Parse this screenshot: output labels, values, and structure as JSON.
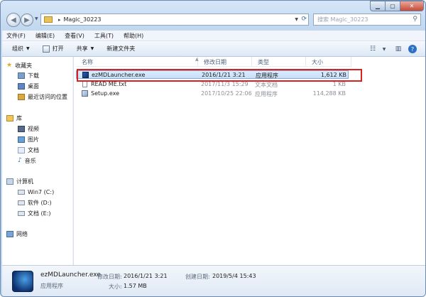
{
  "address": {
    "path": "Magic_30223"
  },
  "search": {
    "placeholder": "搜索 Magic_30223"
  },
  "menu": [
    "文件(F)",
    "编辑(E)",
    "查看(V)",
    "工具(T)",
    "帮助(H)"
  ],
  "toolbar": {
    "organize": "组织",
    "open": "打开",
    "share": "共享",
    "new_folder": "新建文件夹"
  },
  "nav": {
    "favorites": {
      "label": "收藏夹",
      "items": [
        "下载",
        "桌面",
        "最近访问的位置"
      ]
    },
    "library": {
      "label": "库",
      "items": [
        "视频",
        "图片",
        "文档",
        "音乐"
      ]
    },
    "computer": {
      "label": "计算机",
      "items": [
        "Win7 (C:)",
        "软件 (D:)",
        "文档 (E:)"
      ]
    },
    "network": {
      "label": "网络"
    }
  },
  "columns": [
    "名称",
    "修改日期",
    "类型",
    "大小"
  ],
  "files": [
    {
      "name": "ezMDLauncher.exe",
      "date": "2016/1/21 3:21",
      "type": "应用程序",
      "size": "1,612 KB"
    },
    {
      "name": "READ ME.txt",
      "date": "2017/11/3 15:29",
      "type": "文本文档",
      "size": "1 KB"
    },
    {
      "name": "Setup.exe",
      "date": "2017/10/25 22:06",
      "type": "应用程序",
      "size": "114,288 KB"
    }
  ],
  "details": {
    "name": "ezMDLauncher.exe",
    "type": "应用程序",
    "modified_label": "修改日期:",
    "modified": "2016/1/21 3:21",
    "created_label": "创建日期:",
    "created": "2019/5/4 15:43",
    "size_label": "大小:",
    "size": "1.57 MB"
  },
  "colors": {
    "selection": "#c4e0fb",
    "highlight_box": "#d9221e",
    "chrome": "#c2d8f0"
  }
}
